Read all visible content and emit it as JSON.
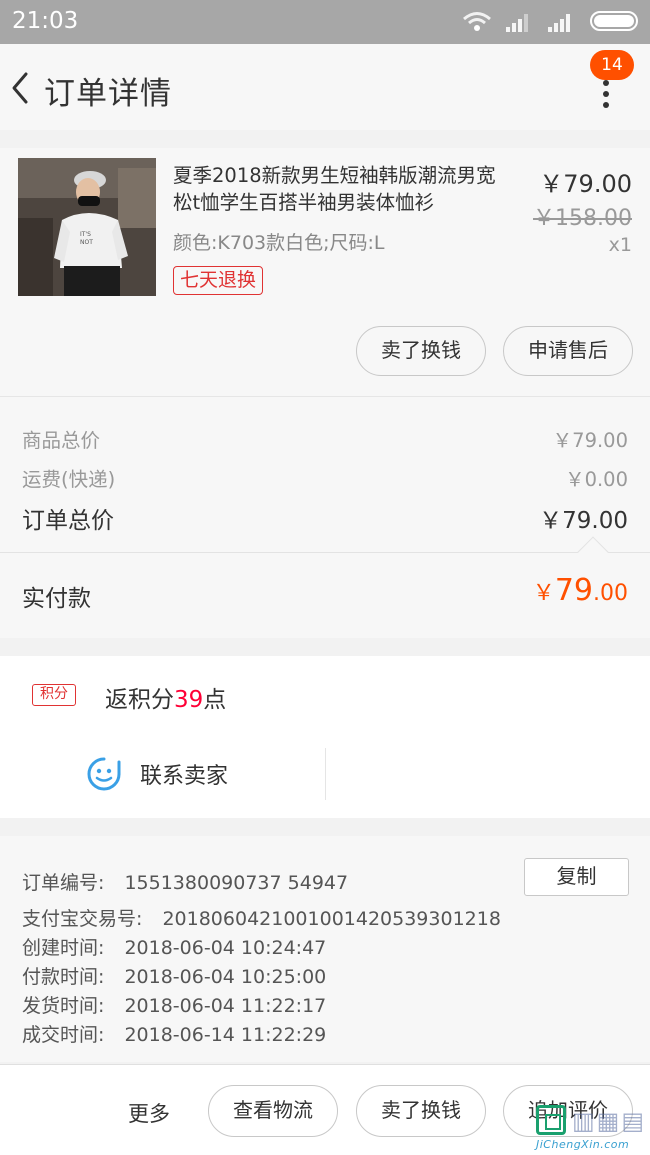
{
  "status_bar": {
    "time": "21:03"
  },
  "header": {
    "title": "订单详情",
    "badge_count": "14"
  },
  "product": {
    "name": "夏季2018新款男生短袖韩版潮流男宽松t恤学生百搭半袖男装体恤衫",
    "spec": "颜色:K703款白色;尺码:L",
    "tag": "七天退换",
    "price": "￥79.00",
    "original_price": "￥158.00",
    "quantity": "x1",
    "buttons": {
      "sell": "卖了换钱",
      "after_sale": "申请售后"
    }
  },
  "summary": {
    "goods_total_label": "商品总价",
    "goods_total_value": "￥79.00",
    "shipping_label": "运费(快递)",
    "shipping_value": "￥0.00",
    "order_total_label": "订单总价",
    "order_total_value": "￥79.00"
  },
  "payment": {
    "label": "实付款",
    "currency": "￥",
    "amount_int": "79",
    "amount_dec": ".00",
    "color": "#ff5000"
  },
  "points": {
    "badge": "积分",
    "prefix": "返积分",
    "value": "39",
    "suffix": "点",
    "contact_label": "联系卖家"
  },
  "order_info": {
    "order_no_label": "订单编号:",
    "order_no": "1551380090737 54947",
    "copy_label": "复制",
    "alipay_label": "支付宝交易号:",
    "alipay_no": "2018060421001001420539301218",
    "created_label": "创建时间:",
    "created": "2018-06-04 10:24:47",
    "paid_label": "付款时间:",
    "paid": "2018-06-04 10:25:00",
    "shipped_label": "发货时间:",
    "shipped": "2018-06-04 11:22:17",
    "closed_label": "成交时间:",
    "closed": "2018-06-14 11:22:29"
  },
  "bottom_bar": {
    "more": "更多",
    "logistics": "查看物流",
    "sell": "卖了换钱",
    "review": "追加评价"
  },
  "watermark": {
    "url": "JiChengXin.com"
  }
}
